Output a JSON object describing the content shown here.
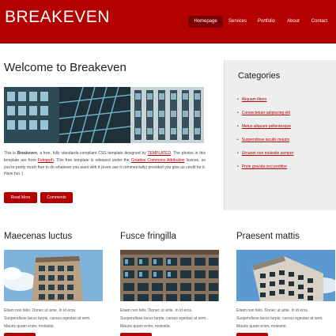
{
  "brand": {
    "logo": "BREAKEVEN",
    "accent": "#b30000"
  },
  "nav": {
    "items": [
      {
        "label": "Homepage",
        "active": true
      },
      {
        "label": "Services",
        "active": false
      },
      {
        "label": "Portfolio",
        "active": false
      },
      {
        "label": "About",
        "active": false
      },
      {
        "label": "Contact",
        "active": false
      }
    ]
  },
  "main": {
    "title": "Welcome to Breakeven",
    "desc": {
      "t1": "This is ",
      "b1": "Breakeven",
      "t2": ", a free, fully standards-compliant CSS template designed by ",
      "l1": "TEMPLATED",
      "t3": ". The photos in this template are from ",
      "l2": "Fotogrph",
      "t4": ". This free template is released under the ",
      "l3": "Creative Commons Attribution",
      "t5": " license, so you're pretty much free to do whatever you want with it (even use it commercially) provided you give us credit for it. Have fun :)"
    },
    "buttons": {
      "read_more": "Read More",
      "comments": "Comments"
    }
  },
  "sidebar": {
    "title": "Categories",
    "items": [
      "Aliquam libero",
      "Consectetuer adipiscing elit",
      "Metus aliquam pellentesque",
      "Suspendisse iaculis mauris",
      "Urnanet non molestie semper",
      "Proin gravida orci porttitor"
    ]
  },
  "columns": [
    {
      "title": "Maecenas luctus",
      "line1": "Etiam non felis. Donec ut ante. In id eros.",
      "line2": "Suspendisse lacus turpis, cursus egestas at sem.",
      "line3": "Mauris quam enim, molestie."
    },
    {
      "title": "Fusce fringilla",
      "line1": "Etiam non felis. Donec ut ante. In id eros.",
      "line2": "Suspendisse lacus turpis, cursus egestas at sem.",
      "line3": "Mauris quam enim, molestie."
    },
    {
      "title": "Praesent mattis",
      "line1": "Etiam non felis. Donec ut ante. In id eros.",
      "line2": "Suspendisse lacus turpis, cursus egestas at sem.",
      "line3": "Mauris quam enim, molestie."
    }
  ]
}
